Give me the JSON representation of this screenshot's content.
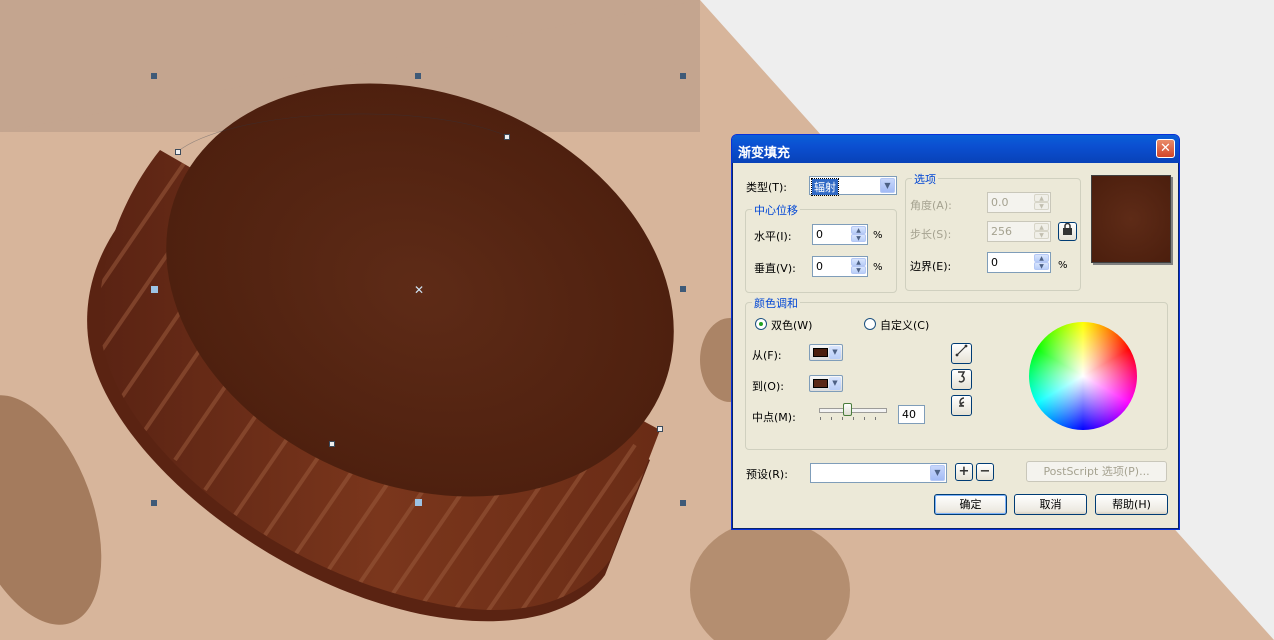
{
  "dialog": {
    "title": "渐变填充",
    "close_symbol": "✕",
    "type_label": "类型(T):",
    "type_value": "辐射",
    "center_group_title": "中心位移",
    "horizontal_label": "水平(I):",
    "horizontal_value": "0",
    "vertical_label": "垂直(V):",
    "vertical_value": "0",
    "percent": "%",
    "options_group_title": "选项",
    "angle_label": "角度(A):",
    "angle_value": "0.0",
    "steps_label": "步长(S):",
    "steps_value": "256",
    "edge_label": "边界(E):",
    "edge_value": "0",
    "preview_color": "#4f2211",
    "blend_group_title": "颜色调和",
    "two_color_label": "双色(W)",
    "custom_label": "自定义(C)",
    "two_color_selected": true,
    "from_label": "从(F):",
    "from_color": "#4a1d0e",
    "to_label": "到(O):",
    "to_color": "#5b2816",
    "midpoint_label": "中点(M):",
    "midpoint_value": "40",
    "midpoint_fraction": 0.4,
    "preset_label": "预设(R):",
    "preset_value": "",
    "postscript_label": "PostScript 选项(P)...",
    "ok_label": "确定",
    "cancel_label": "取消",
    "help_label": "帮助(H)"
  },
  "icons": {
    "lock": "lock-icon",
    "line_direction": "direct-blend-icon",
    "counter_clockwise": "ccw-blend-icon",
    "clockwise": "cw-blend-icon",
    "add_preset": "plus-icon",
    "remove_preset": "minus-icon"
  }
}
